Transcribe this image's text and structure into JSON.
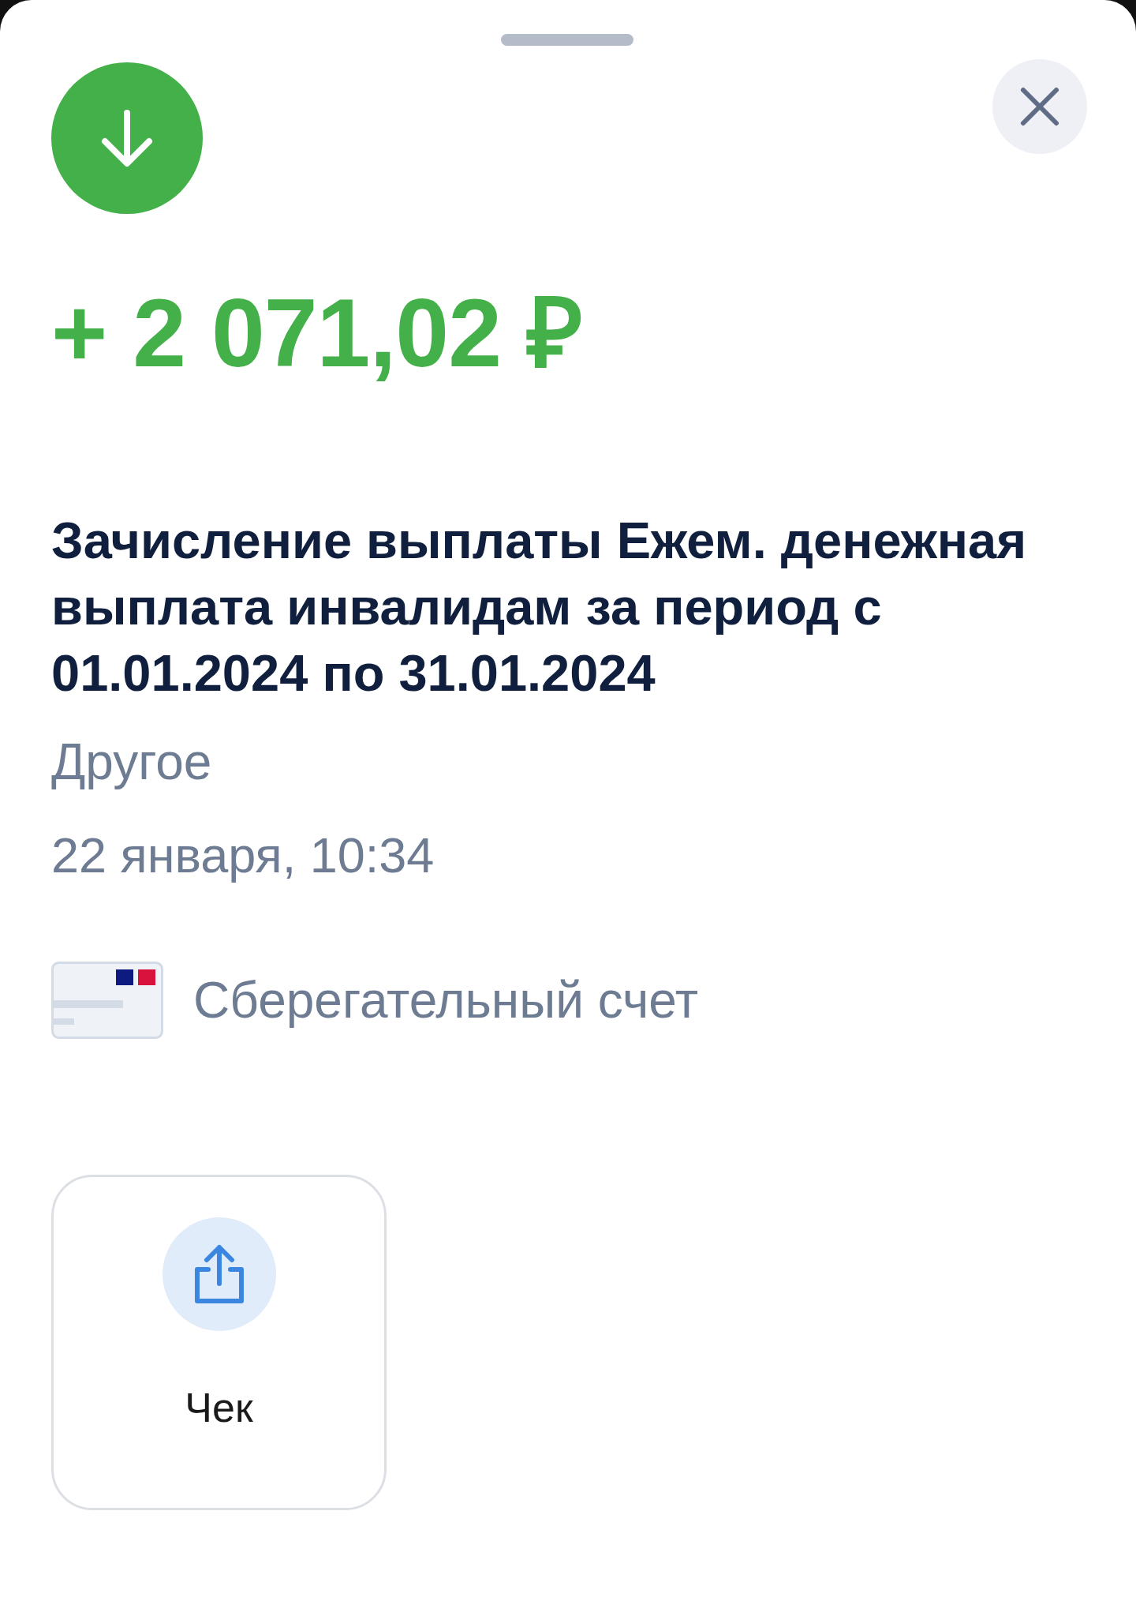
{
  "amount": "+ 2 071,02 ₽",
  "description": "Зачисление выплаты Ежем. денежная выплата инвалидам за период с 01.01.2024 по 31.01.2024",
  "category": "Другое",
  "datetime": "22 января, 10:34",
  "account": {
    "name": "Сберегательный счет"
  },
  "actions": [
    {
      "label": "Чек"
    }
  ]
}
